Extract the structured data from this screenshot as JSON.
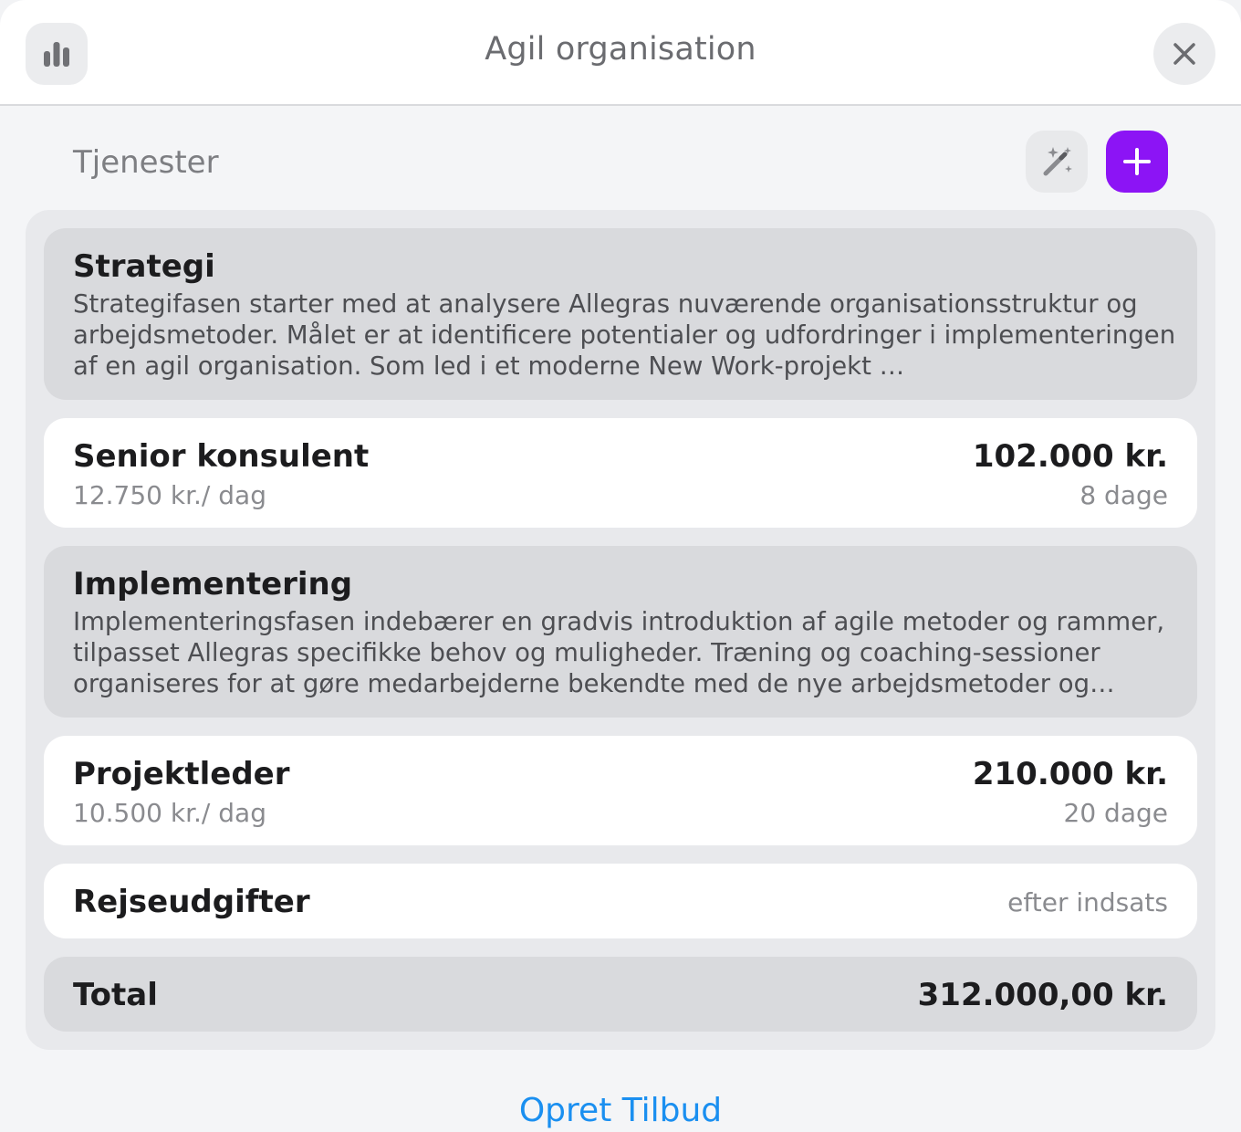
{
  "header": {
    "title": "Agil organisation",
    "stats_icon": "bar-chart-icon",
    "close_icon": "close-icon"
  },
  "services": {
    "label": "Tjenester",
    "magic_icon": "magic-wand-icon",
    "add_icon": "plus-icon"
  },
  "phases": [
    {
      "title": "Strategi",
      "description": "Strategifasen starter med at analysere Allegras nuværende organisationsstruktur og arbejdsmetoder. Målet er at identificere potentialer og udfordringer i implementeringen af en agil organisation. Som led i et moderne New Work-projekt …"
    },
    {
      "title": "Implementering",
      "description": "Implementeringsfasen indebærer en gradvis introduktion af agile metoder og rammer, tilpasset Allegras specifikke behov og muligheder. Træning og coaching-sessioner organiseres for at gøre medarbejderne bekendte med de nye arbejdsmetoder og styrk…"
    }
  ],
  "items": [
    {
      "name": "Senior konsulent",
      "rate": "12.750 kr./ dag",
      "amount": "102.000 kr.",
      "days": "8 dage"
    },
    {
      "name": "Projektleder",
      "rate": "10.500 kr./ dag",
      "amount": "210.000 kr.",
      "days": "20 dage"
    }
  ],
  "expenses": {
    "name": "Rejseudgifter",
    "note": "efter indsats"
  },
  "total": {
    "label": "Total",
    "value": "312.000,00 kr."
  },
  "footer": {
    "create_label": "Opret Tilbud"
  },
  "colors": {
    "accent": "#8c14f5",
    "link": "#1a8ff0"
  }
}
